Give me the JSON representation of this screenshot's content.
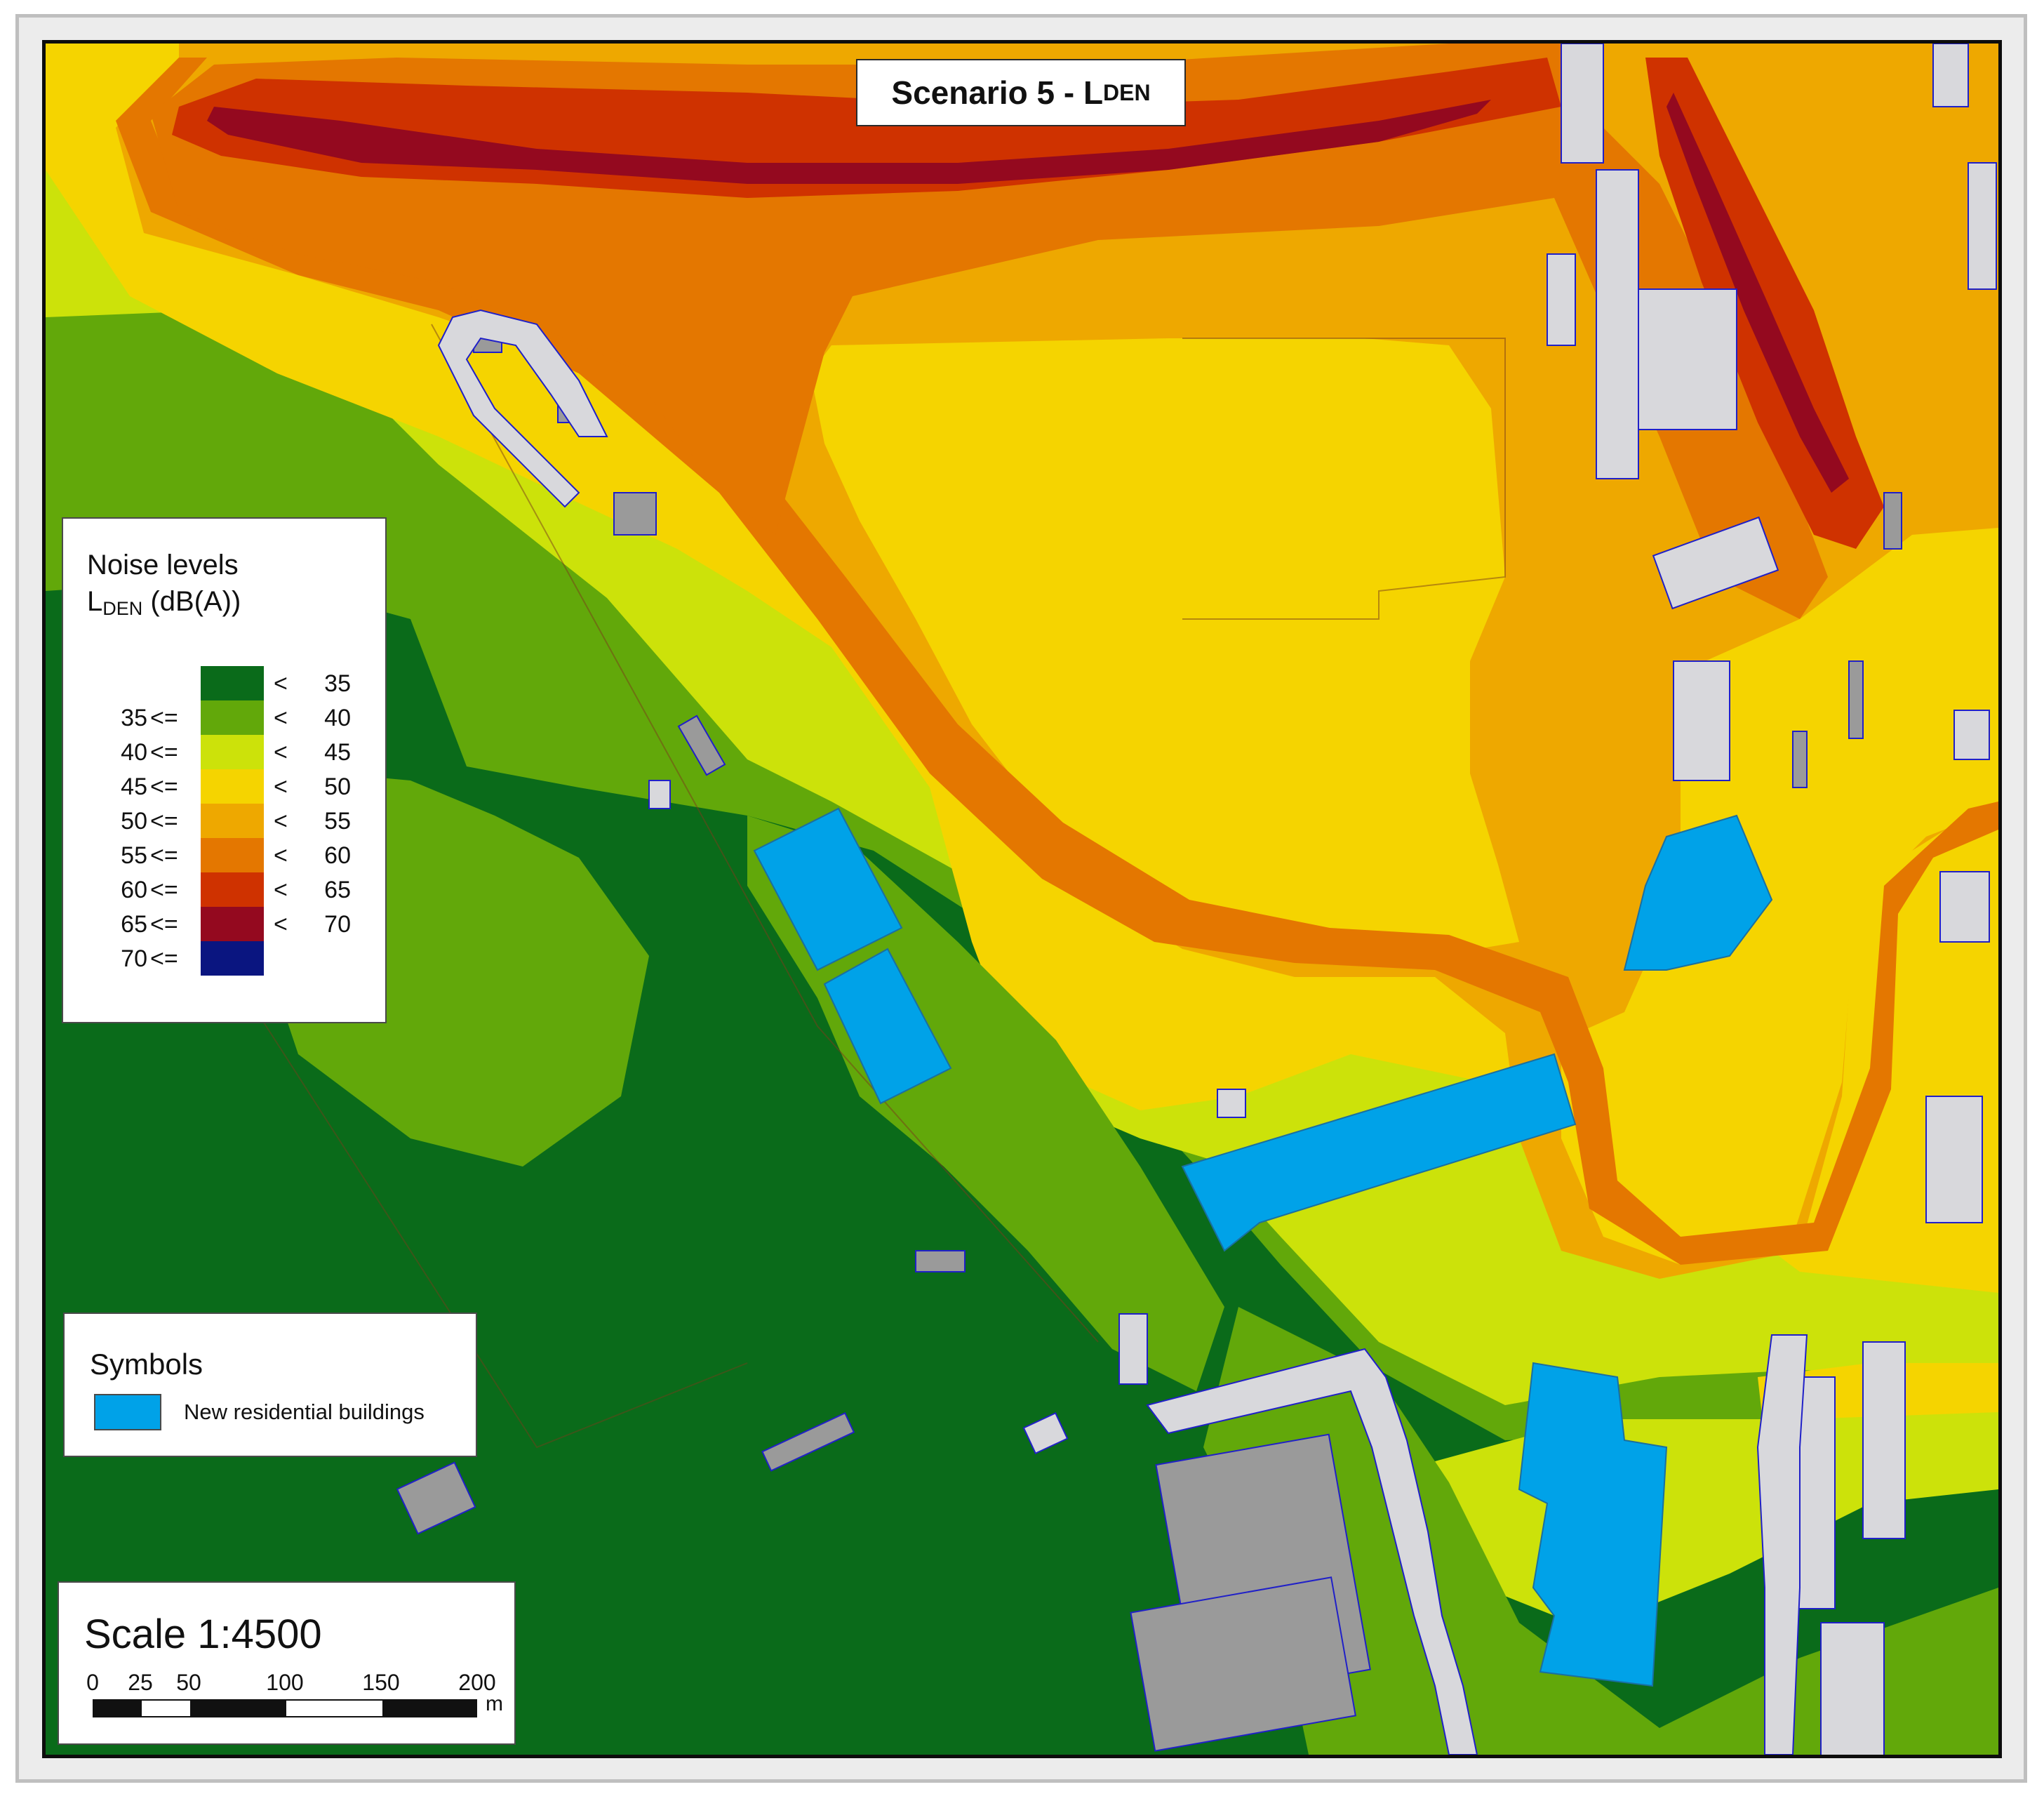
{
  "map_title": {
    "main": "Scenario 5 - L",
    "sub": "DEN"
  },
  "legend": {
    "title_line1": "Noise levels",
    "title_line2_main": "L",
    "title_line2_sub": "DEN",
    "title_line2_unit": " (dB(A))",
    "classes": [
      {
        "low": "",
        "le": "",
        "lt": "<",
        "high": "35",
        "color": "#0a6b1a"
      },
      {
        "low": "35",
        "le": "<=",
        "lt": "<",
        "high": "40",
        "color": "#62a80a"
      },
      {
        "low": "40",
        "le": "<=",
        "lt": "<",
        "high": "45",
        "color": "#cce20a"
      },
      {
        "low": "45",
        "le": "<=",
        "lt": "<",
        "high": "50",
        "color": "#f5d400"
      },
      {
        "low": "50",
        "le": "<=",
        "lt": "<",
        "high": "55",
        "color": "#eea800"
      },
      {
        "low": "55",
        "le": "<=",
        "lt": "<",
        "high": "60",
        "color": "#e47700"
      },
      {
        "low": "60",
        "le": "<=",
        "lt": "<",
        "high": "65",
        "color": "#cf3200"
      },
      {
        "low": "65",
        "le": "<=",
        "lt": "<",
        "high": "70",
        "color": "#94091f"
      },
      {
        "low": "70",
        "le": "<=",
        "lt": "",
        "high": "",
        "color": "#0a1580"
      }
    ]
  },
  "symbols": {
    "title": "Symbols",
    "items": [
      {
        "label": "New residential buildings",
        "color": "#00a2e8"
      }
    ]
  },
  "scale": {
    "title": "Scale 1:4500",
    "ticks": [
      "0",
      "25",
      "50",
      "100",
      "150",
      "200"
    ],
    "unit": "m"
  },
  "colors": {
    "building": "#9a9a9a",
    "building_light": "#d8d8dc",
    "new_building": "#00a2e8",
    "outline": "#2020c8"
  }
}
